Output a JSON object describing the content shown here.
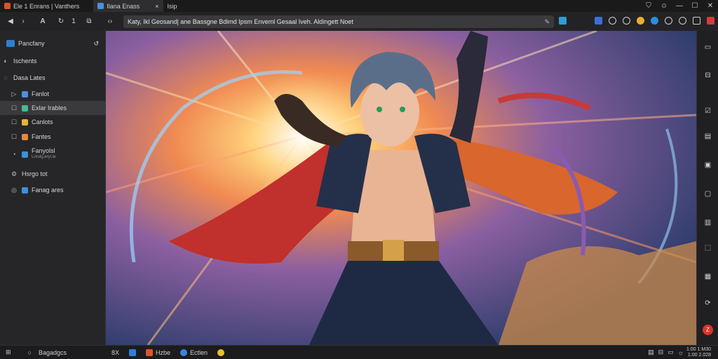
{
  "titlebar": {
    "tabs": [
      {
        "label": "Ele 1 Enrans  |  Vanthers",
        "color": "#d9532c"
      },
      {
        "label": "Ilana Enass",
        "color": "#4a90d9"
      },
      {
        "label": "Isip",
        "color": "#888888"
      }
    ],
    "close_tab_glyph": "×",
    "controls": {
      "minimize": "—",
      "maximize": "☐",
      "close": "✕"
    }
  },
  "toolbar": {
    "back_glyph": "◀",
    "forward_glyph": "›",
    "a_glyph": "A",
    "refresh_glyph": "↻",
    "count": "1",
    "copy_glyph": "⧉",
    "tabs_glyph": "‹›",
    "address_value": "Katy, Ikl Geosand| ane Bassgne Bdimd Ipsm Enveml Gesaal Iveh. Aldingett Noet",
    "ext_colors": [
      "#2aa0d8",
      "#3b6fd9",
      "#cfcfcf",
      "#cfcfcf",
      "#e8b02c",
      "#2a8ee0",
      "#cfcfcf",
      "#cfcfcf",
      "#cfcfcf",
      "#d93a3a"
    ]
  },
  "sidebar": {
    "header": {
      "label": "Pancfany",
      "right_glyph": "↺",
      "icon_color": "#2f7fd1"
    },
    "items": [
      {
        "lead": "◐",
        "label": "Ischents",
        "icon_color": "",
        "sub": "",
        "selected": false
      },
      {
        "lead": "◌",
        "label": "Dasa Lates",
        "icon_color": "",
        "sub": "",
        "selected": false
      },
      {
        "lead": "▷",
        "label": "Fanlot",
        "icon_color": "#4f8fd9",
        "sub": "",
        "selected": false
      },
      {
        "lead": "☐",
        "label": "Exlar Irables",
        "icon_color": "#3fbf8f",
        "sub": "",
        "selected": true
      },
      {
        "lead": "☐",
        "label": "Canlots",
        "icon_color": "#e3b33a",
        "sub": "",
        "selected": false
      },
      {
        "lead": "☐",
        "label": "Fantes",
        "icon_color": "#e38a3a",
        "sub": "",
        "selected": false
      },
      {
        "lead": "◔",
        "label": "Fanyolsl",
        "icon_color": "#3f8fd9",
        "sub": "Lorulg.eryi.la",
        "selected": false
      },
      {
        "lead": "⚙",
        "label": "Hsrgo tot",
        "icon_color": "",
        "sub": "",
        "selected": false
      },
      {
        "lead": "◎",
        "label": "Fanag ares",
        "icon_color": "#3f8fd9",
        "sub": "",
        "selected": false
      }
    ]
  },
  "rail": {
    "buttons": [
      "▭",
      "⊟",
      "☑",
      "▤",
      "▣",
      "▢",
      "▥",
      "⬚",
      "▦",
      "⟳",
      "Z"
    ]
  },
  "statusbar": {
    "items": [
      {
        "glyph": "⊞",
        "label": "",
        "color": ""
      },
      {
        "glyph": "○",
        "label": "Bagadgcs",
        "color": ""
      },
      {
        "glyph": "8X",
        "label": "",
        "color": ""
      },
      {
        "glyph": "",
        "label": "",
        "color": "#2a7fd8"
      },
      {
        "glyph": "",
        "label": "Hzbe",
        "color": "#e0532c"
      },
      {
        "glyph": "",
        "label": "Ectlen",
        "color": "#3a84d9"
      },
      {
        "glyph": "",
        "label": "",
        "color": "#e8c02a"
      }
    ],
    "right_icons": [
      "▤",
      "⊟",
      "▭",
      "☼"
    ],
    "time": "1:00 1:M30",
    "date": "1:00 2.028"
  }
}
